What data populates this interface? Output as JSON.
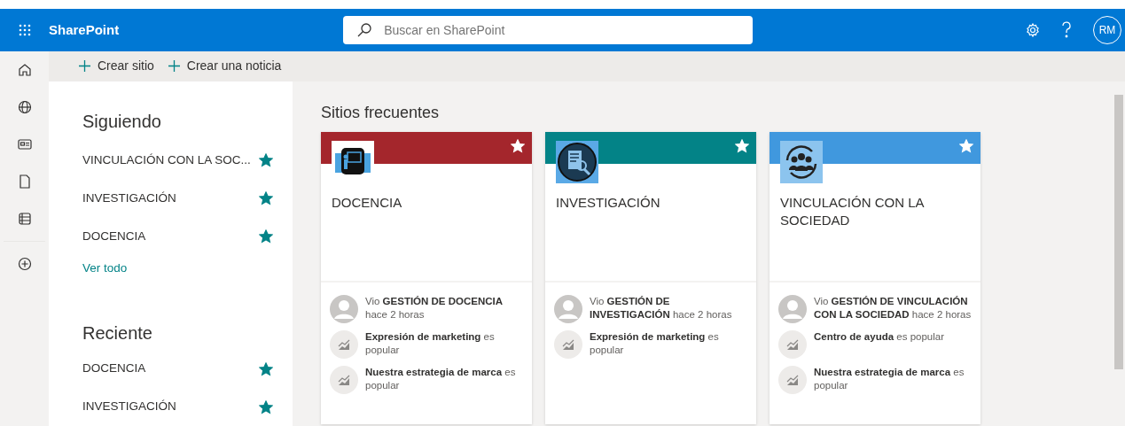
{
  "header": {
    "app_name": "SharePoint",
    "search": {
      "placeholder": "Buscar en SharePoint"
    },
    "avatar": "RM"
  },
  "commands": [
    "Crear sitio",
    "Crear una noticia"
  ],
  "following": {
    "title": "Siguiendo",
    "items": [
      {
        "label": "VINCULACIÓN CON LA SOC...",
        "following": true
      },
      {
        "label": "INVESTIGACIÓN",
        "following": true
      },
      {
        "label": "DOCENCIA",
        "following": true
      }
    ],
    "see_all": "Ver todo"
  },
  "recent": {
    "title": "Reciente",
    "items": [
      {
        "label": "DOCENCIA",
        "following": true
      },
      {
        "label": "INVESTIGACIÓN",
        "following": true
      }
    ]
  },
  "frequent": {
    "title": "Sitios frecuentes",
    "sites": [
      {
        "name": "DOCENCIA",
        "color": "#a4262c",
        "kind": "presentation",
        "following": true,
        "activity": [
          {
            "kind": "viewed",
            "text": "Vio **GESTIÓN DE DOCENCIA** hace 2 horas"
          },
          {
            "kind": "popular",
            "text": "**Expresión de marketing** es popular"
          },
          {
            "kind": "popular",
            "text": "**Nuestra estrategia de marca** es popular"
          }
        ]
      },
      {
        "name": "INVESTIGACIÓN",
        "color": "#038387",
        "kind": "search",
        "following": true,
        "activity": [
          {
            "kind": "viewed",
            "text": "Vio **GESTIÓN DE INVESTIGACIÓN** hace 2 horas"
          },
          {
            "kind": "popular",
            "text": "**Expresión de marketing** es popular"
          }
        ]
      },
      {
        "name": "VINCULACIÓN CON LA SOCIEDAD",
        "color": "#4098de",
        "kind": "people",
        "following": true,
        "activity": [
          {
            "kind": "viewed",
            "text": "Vio **GESTIÓN DE VINCULACIÓN CON LA SOCIEDAD** hace 2 horas"
          },
          {
            "kind": "popular",
            "text": "**Centro de ayuda** es popular"
          },
          {
            "kind": "popular",
            "text": "**Nuestra estrategia de marca** es popular"
          }
        ]
      }
    ]
  }
}
